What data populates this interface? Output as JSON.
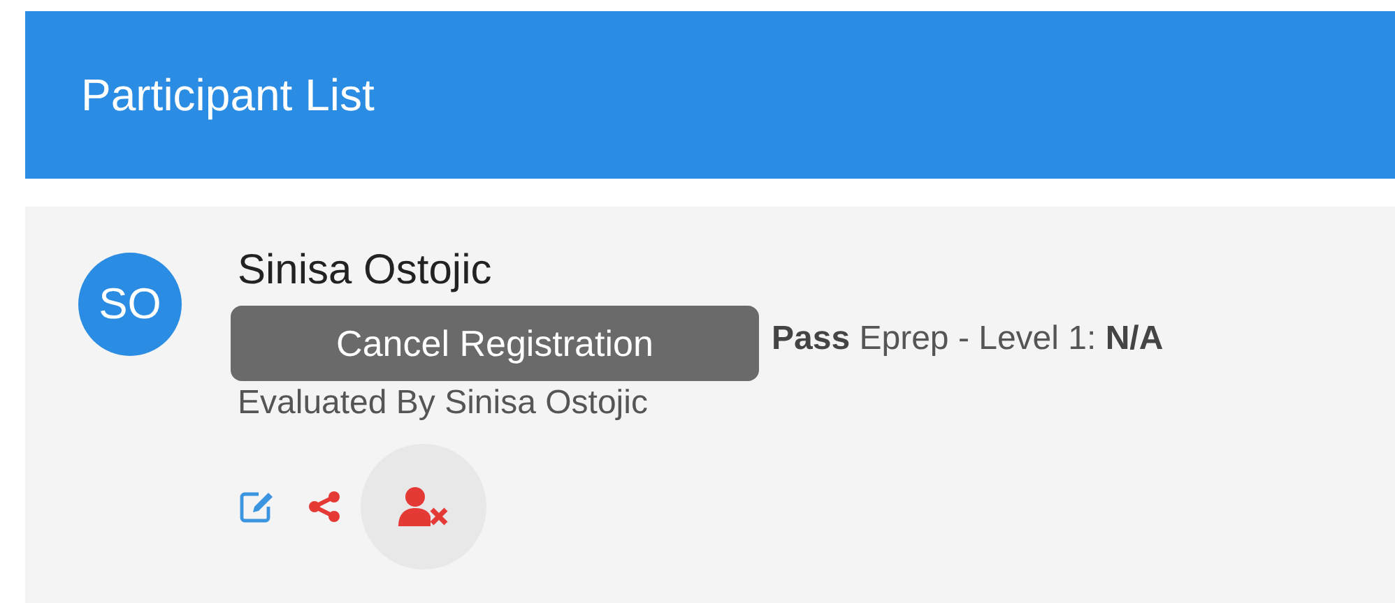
{
  "header": {
    "title": "Participant List"
  },
  "participants": [
    {
      "initials": "SO",
      "name": "Sinisa Ostojic",
      "details": "**Pass** Eprep - Level 1: **N/A**",
      "evaluated_by": "Evaluated By Sinisa Ostojic",
      "actions": [
        {
          "kind": "edit",
          "hovered": false
        },
        {
          "kind": "share",
          "hovered": false
        },
        {
          "kind": "cancel",
          "hovered": true
        }
      ]
    }
  ],
  "tooltip": {
    "text": "Cancel Registration"
  }
}
